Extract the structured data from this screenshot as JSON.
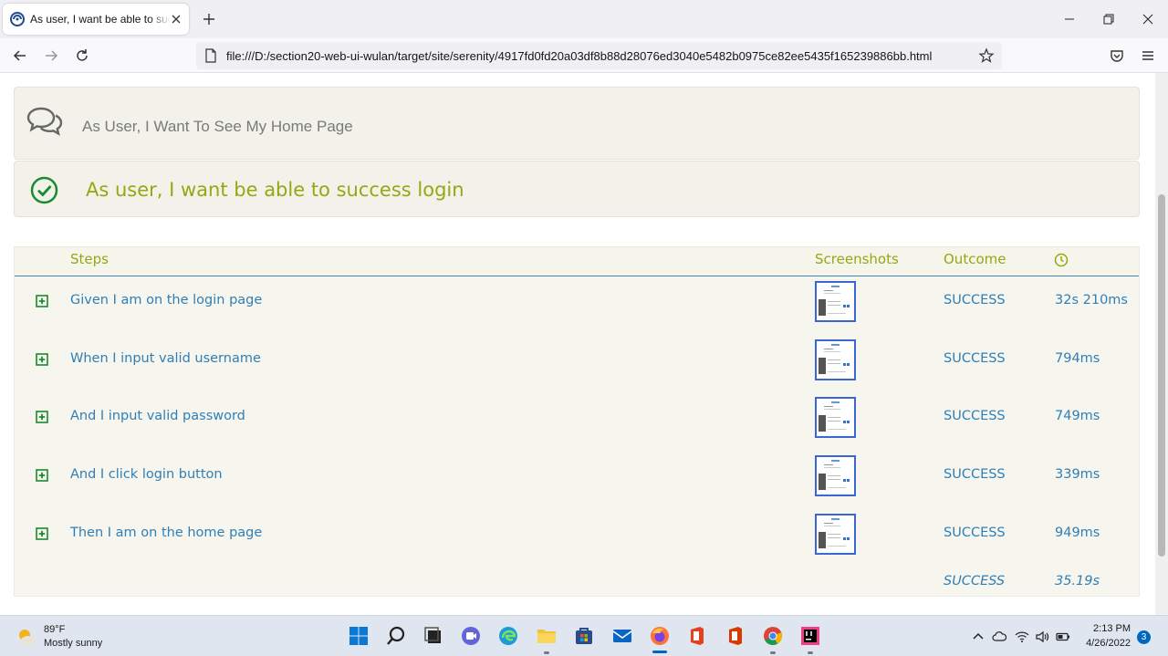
{
  "browser": {
    "tab_title": "As user, I want be able to success login",
    "url": "file:///D:/section20-web-ui-wulan/target/site/serenity/4917fd0fd20a03df8b88d28076ed3040e5482b0975ce82ee5435f165239886bb.html"
  },
  "story": {
    "title": "As User, I Want To See My Home Page"
  },
  "scenario": {
    "title": "As user, I want be able to success login",
    "status_color": "#1a8a2e"
  },
  "steps_table": {
    "headers": {
      "steps": "Steps",
      "screenshots": "Screenshots",
      "outcome": "Outcome"
    },
    "rows": [
      {
        "description": "Given I am on the login page",
        "outcome": "SUCCESS",
        "duration": "32s 210ms"
      },
      {
        "description": "When I input valid username",
        "outcome": "SUCCESS",
        "duration": "794ms"
      },
      {
        "description": "And I input valid password",
        "outcome": "SUCCESS",
        "duration": "749ms"
      },
      {
        "description": "And I click login button",
        "outcome": "SUCCESS",
        "duration": "339ms"
      },
      {
        "description": "Then I am on the home page",
        "outcome": "SUCCESS",
        "duration": "949ms"
      }
    ],
    "total": {
      "outcome": "SUCCESS",
      "duration": "35.19s"
    }
  },
  "taskbar": {
    "weather_temp": "89°F",
    "weather_desc": "Mostly sunny",
    "time": "2:13 PM",
    "date": "4/26/2022",
    "notifications": "3"
  },
  "colors": {
    "accent_green": "#94a813",
    "link_blue": "#2f7fb6",
    "header_rule": "#3d86b6"
  }
}
